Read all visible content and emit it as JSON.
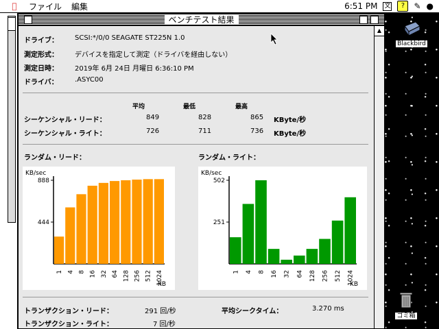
{
  "menubar": {
    "menu_items": [
      "ファイル",
      "編集"
    ],
    "clock": "6:51 PM",
    "ime_label": "文",
    "help_label": "?"
  },
  "window": {
    "title": "ベンチテスト結果",
    "info": [
      {
        "label": "ドライブ：",
        "value": "SCSI:*/0/0  SEAGATE        ST225N 1.0"
      },
      {
        "label": "測定形式：",
        "value": "デバイスを指定して測定（ドライバを経由しない）"
      },
      {
        "label": "測定日時：",
        "value": "2019年 6月 24日 月曜日     6:36:10 PM"
      },
      {
        "label": "ドライバ：",
        "value": ".ASYC00"
      }
    ],
    "table": {
      "headers": [
        "平均",
        "最低",
        "最高"
      ],
      "rows": [
        {
          "label": "シーケンシャル・リード：",
          "avg": "849",
          "min": "828",
          "max": "865",
          "unit": "KByte/秒"
        },
        {
          "label": "シーケンシャル・ライト：",
          "avg": "726",
          "min": "711",
          "max": "736",
          "unit": "KByte/秒"
        }
      ]
    },
    "random_read_label": "ランダム・リード：",
    "random_write_label": "ランダム・ライト：",
    "footer": {
      "tx_read_label": "トランザクション・リード：",
      "tx_read_value": "291 回/秒",
      "tx_write_label": "トランザクション・ライト：",
      "tx_write_value": "7 回/秒",
      "seek_label": "平均シークタイム：",
      "seek_value": "3.270 ms"
    }
  },
  "desktop": {
    "icon_blackbird": "Blackbird",
    "icon_trash": "ゴミ箱"
  },
  "chart_data": [
    {
      "type": "bar",
      "color": "#ff9900",
      "ylabel": "KB/sec",
      "xlabel": "KB",
      "yticks": [
        "888",
        "444"
      ],
      "ymax": 888,
      "categories": [
        "1",
        "4",
        "8",
        "16",
        "32",
        "64",
        "128",
        "256",
        "512",
        "1024"
      ],
      "values": [
        290,
        600,
        740,
        830,
        860,
        880,
        888,
        895,
        900,
        900
      ]
    },
    {
      "type": "bar",
      "color": "#009900",
      "ylabel": "KB/sec",
      "xlabel": "KB",
      "yticks": [
        "502",
        "251"
      ],
      "ymax": 502,
      "categories": [
        "1",
        "4",
        "8",
        "16",
        "32",
        "64",
        "128",
        "256",
        "512",
        "1024"
      ],
      "values": [
        160,
        360,
        502,
        90,
        25,
        50,
        90,
        150,
        260,
        400
      ]
    }
  ]
}
